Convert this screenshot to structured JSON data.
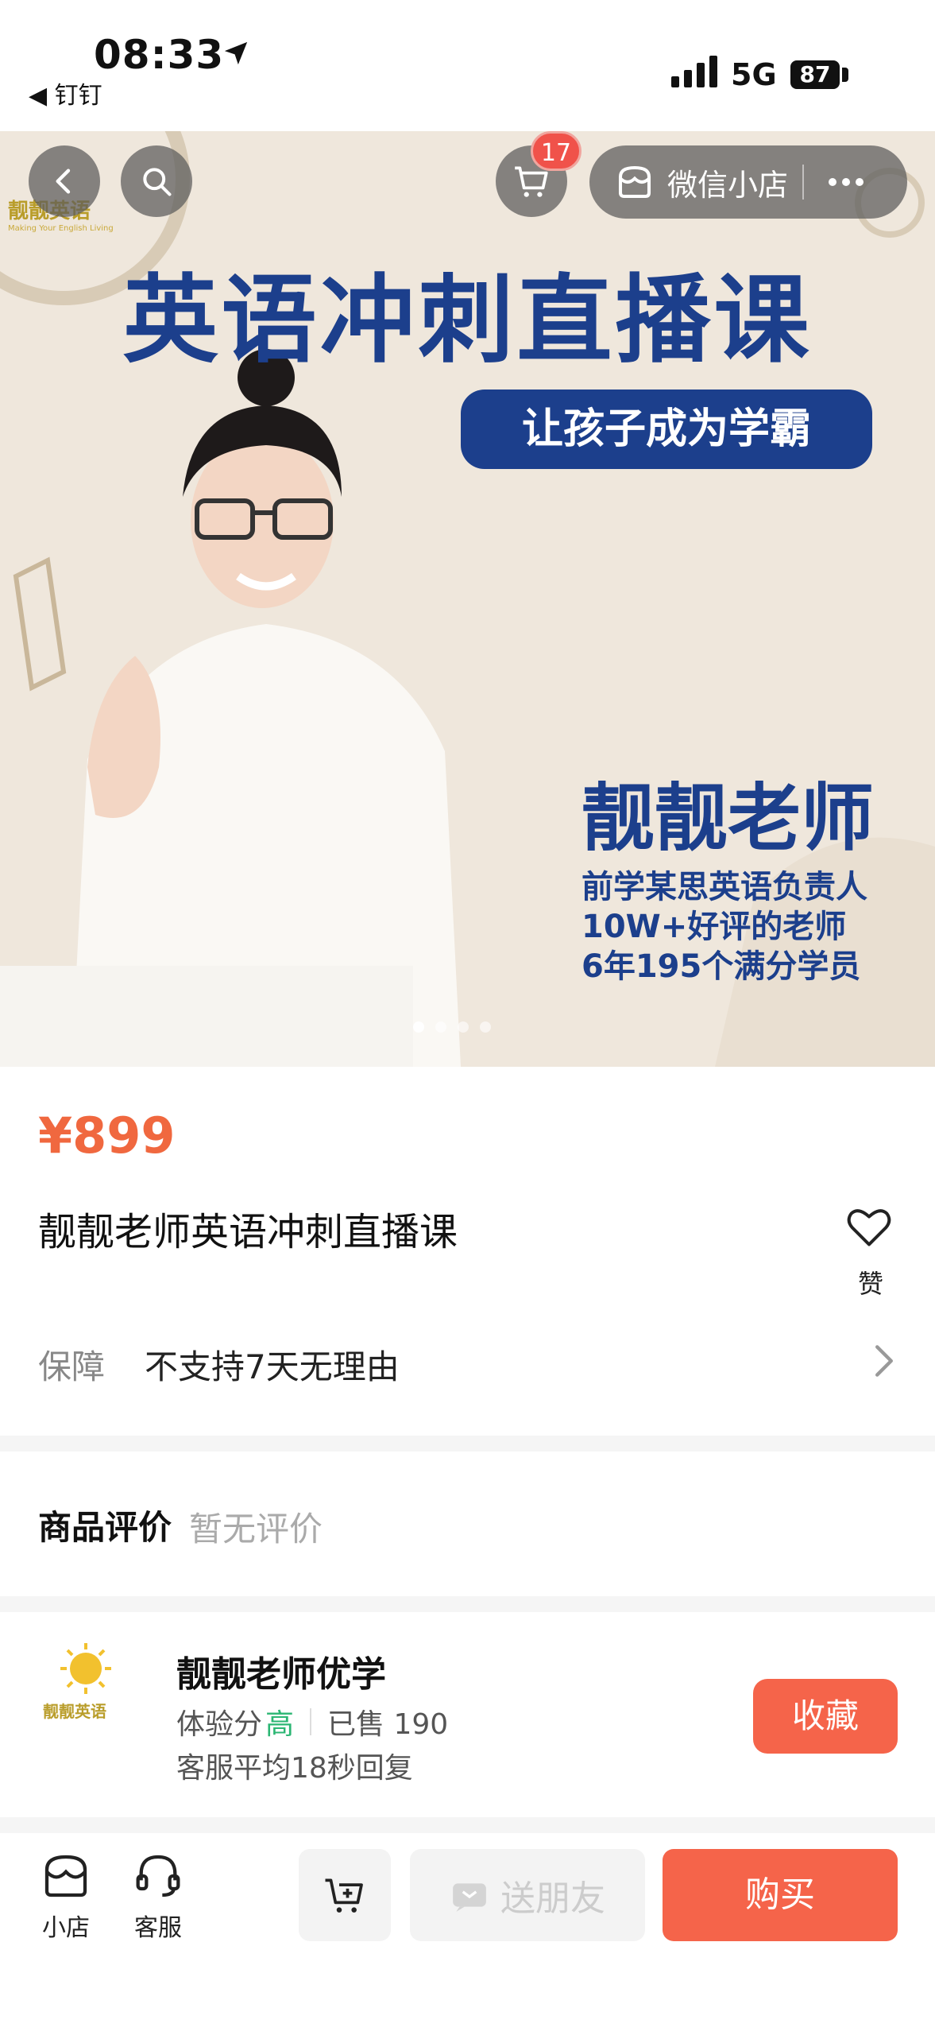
{
  "status_bar": {
    "time": "08:33",
    "back_app": "◀ 钉钉",
    "network": "5G",
    "battery": "87"
  },
  "hero": {
    "cart_count": "17",
    "shop_pill_label": "微信小店",
    "title": "英语冲刺直播课",
    "slogan": "让孩子成为学霸",
    "teacher_name": "靓靓老师",
    "lines": [
      "前学某思英语负责人",
      "10W+好评的老师",
      "6年195个满分学员"
    ],
    "logo_text": "靓靓英语",
    "logo_sub": "Making Your English Living",
    "slide_count": 4,
    "active_slide": 0
  },
  "product": {
    "price": "¥899",
    "name": "靓靓老师英语冲刺直播课",
    "like_label": "赞",
    "guarantee_title": "保障",
    "guarantee_text": "不支持7天无理由"
  },
  "reviews": {
    "title": "商品评价",
    "empty_text": "暂无评价"
  },
  "shop": {
    "name": "靓靓老师优学",
    "score_label": "体验分",
    "score_value": "高",
    "sold_label": "已售 190",
    "reply_text": "客服平均18秒回复",
    "favorite_label": "收藏",
    "logo_text": "靓靓英语"
  },
  "bottom": {
    "shop_tab": "小店",
    "service_tab": "客服",
    "share_label": "送朋友",
    "buy_label": "购买"
  },
  "colors": {
    "accent": "#f5644a",
    "price": "#f0683f",
    "hero_blue": "#1c3f8c",
    "hero_bg": "#efe7dc"
  }
}
